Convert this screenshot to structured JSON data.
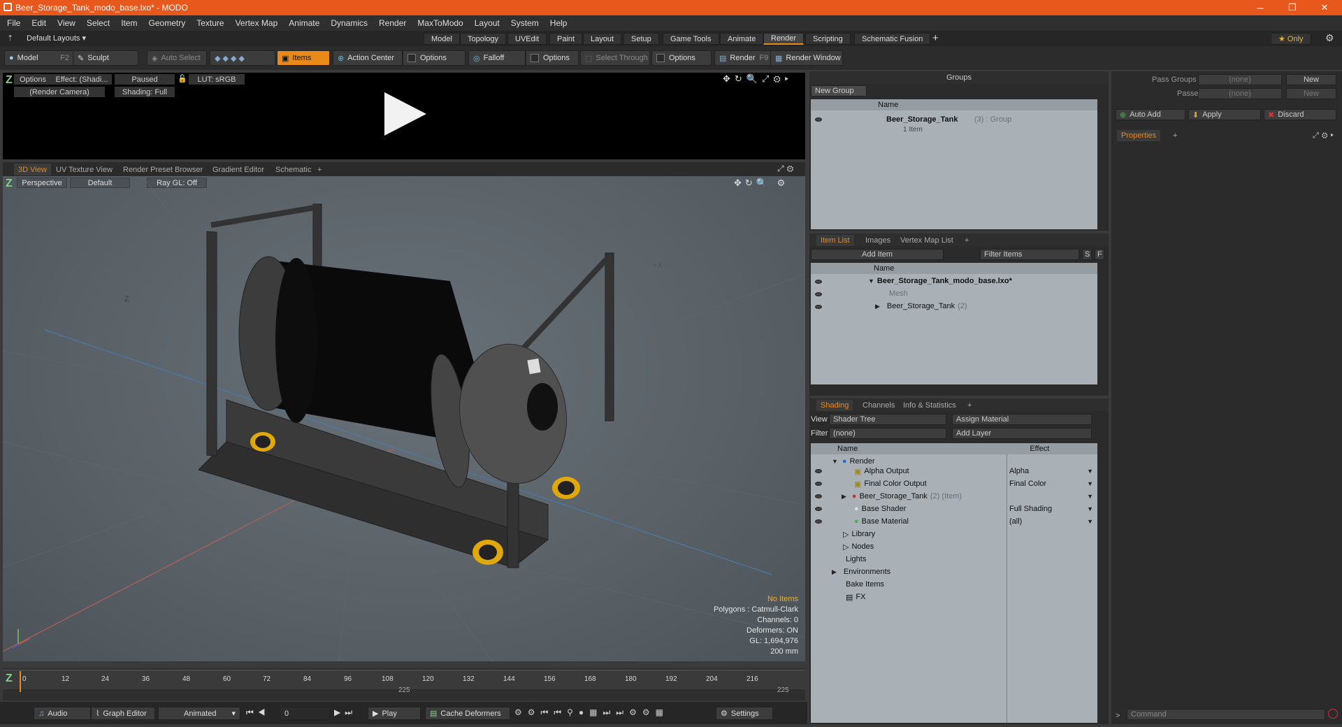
{
  "window": {
    "title": "Beer_Storage_Tank_modo_base.lxo* - MODO",
    "minimize": "─",
    "restore": "❐",
    "close": "✕"
  },
  "menu": [
    "File",
    "Edit",
    "View",
    "Select",
    "Item",
    "Geometry",
    "Texture",
    "Vertex Map",
    "Animate",
    "Dynamics",
    "Render",
    "MaxToModo",
    "Layout",
    "System",
    "Help"
  ],
  "layout": {
    "selector": "Default Layouts ▾",
    "tabs": [
      "Model",
      "Topology",
      "UVEdit",
      "Paint",
      "Layout",
      "Setup",
      "Game Tools",
      "Animate",
      "Render",
      "Scripting",
      "Schematic Fusion"
    ],
    "active": "Render",
    "add": "+",
    "only": "★  Only"
  },
  "toolbar": {
    "model": "Model",
    "model_key": "F2",
    "sculpt": "Sculpt",
    "auto_select": "Auto Select",
    "items": "Items",
    "action_center": "Action Center",
    "options1": "Options",
    "falloff": "Falloff",
    "options2": "Options",
    "select_through": "Select Through",
    "options3": "Options",
    "render": "Render",
    "render_key": "F9",
    "render_window": "Render Window"
  },
  "preview": {
    "options": "Options",
    "effect": "Effect: (Shadi...",
    "paused": "Paused",
    "lut": "LUT: sRGB",
    "camera": "(Render Camera)",
    "shading": "Shading: Full"
  },
  "viewport_tabs": [
    "3D View",
    "UV Texture View",
    "Render Preset Browser",
    "Gradient Editor",
    "Schematic",
    "+"
  ],
  "viewport": {
    "perspective": "Perspective",
    "default": "Default",
    "raygl": "Ray GL: Off",
    "axis_z": "Z",
    "axis_x": "+X"
  },
  "stats": {
    "no_items": "No Items",
    "polygons": "Polygons : Catmull-Clark",
    "channels": "Channels: 0",
    "deformers": "Deformers: ON",
    "gl": "GL: 1,694,976",
    "scale": "200 mm"
  },
  "timeline": {
    "ticks": [
      "0",
      "12",
      "24",
      "36",
      "48",
      "60",
      "72",
      "84",
      "96",
      "108",
      "120",
      "132",
      "144",
      "156",
      "168",
      "180",
      "192",
      "204",
      "216"
    ],
    "end_mid": "225",
    "end_right": "225"
  },
  "bottom": {
    "audio": "Audio",
    "graph_editor": "Graph Editor",
    "animated": "Animated",
    "frame": "0",
    "play": "Play",
    "cache": "Cache Deformers",
    "settings": "Settings"
  },
  "groups": {
    "title": "Groups",
    "new_group": "New Group",
    "col_name": "Name",
    "item_name": "Beer_Storage_Tank",
    "item_suffix": "(3) : Group",
    "item_sub": "1 Item"
  },
  "itemlist": {
    "tabs": [
      "Item List",
      "Images",
      "Vertex Map List",
      "+"
    ],
    "add_item": "Add Item",
    "filter": "Filter Items",
    "s": "S",
    "f": "F",
    "col_name": "Name",
    "rows": [
      {
        "name": "Beer_Storage_Tank_modo_base.lxo*"
      },
      {
        "name": "Mesh"
      },
      {
        "name": "Beer_Storage_Tank",
        "suffix": "(2)"
      }
    ]
  },
  "shading": {
    "tabs": [
      "Shading",
      "Channels",
      "Info & Statistics",
      "+"
    ],
    "view_label": "View",
    "view_value": "Shader Tree",
    "assign": "Assign Material",
    "filter_label": "Filter",
    "filter_value": "(none)",
    "add_layer": "Add Layer",
    "col_name": "Name",
    "col_effect": "Effect",
    "rows": [
      {
        "name": "Render",
        "effect": ""
      },
      {
        "name": "Alpha Output",
        "effect": "Alpha"
      },
      {
        "name": "Final Color Output",
        "effect": "Final Color"
      },
      {
        "name": "Beer_Storage_Tank",
        "suffix": "(2) (Item)",
        "effect": ""
      },
      {
        "name": "Base Shader",
        "effect": "Full Shading"
      },
      {
        "name": "Base Material",
        "effect": "(all)"
      },
      {
        "name": "Library",
        "effect": ""
      },
      {
        "name": "Nodes",
        "effect": ""
      },
      {
        "name": "Lights",
        "effect": ""
      },
      {
        "name": "Environments",
        "effect": ""
      },
      {
        "name": "Bake Items",
        "effect": ""
      },
      {
        "name": "FX",
        "effect": ""
      }
    ]
  },
  "properties": {
    "pass_groups": "Pass Groups",
    "passes": "Passes",
    "none1": "(none)",
    "none2": "(none)",
    "new1": "New",
    "new2": "New",
    "auto_add": "Auto Add",
    "apply": "Apply",
    "discard": "Discard",
    "tab": "Properties",
    "add": "+",
    "command": "Command"
  }
}
